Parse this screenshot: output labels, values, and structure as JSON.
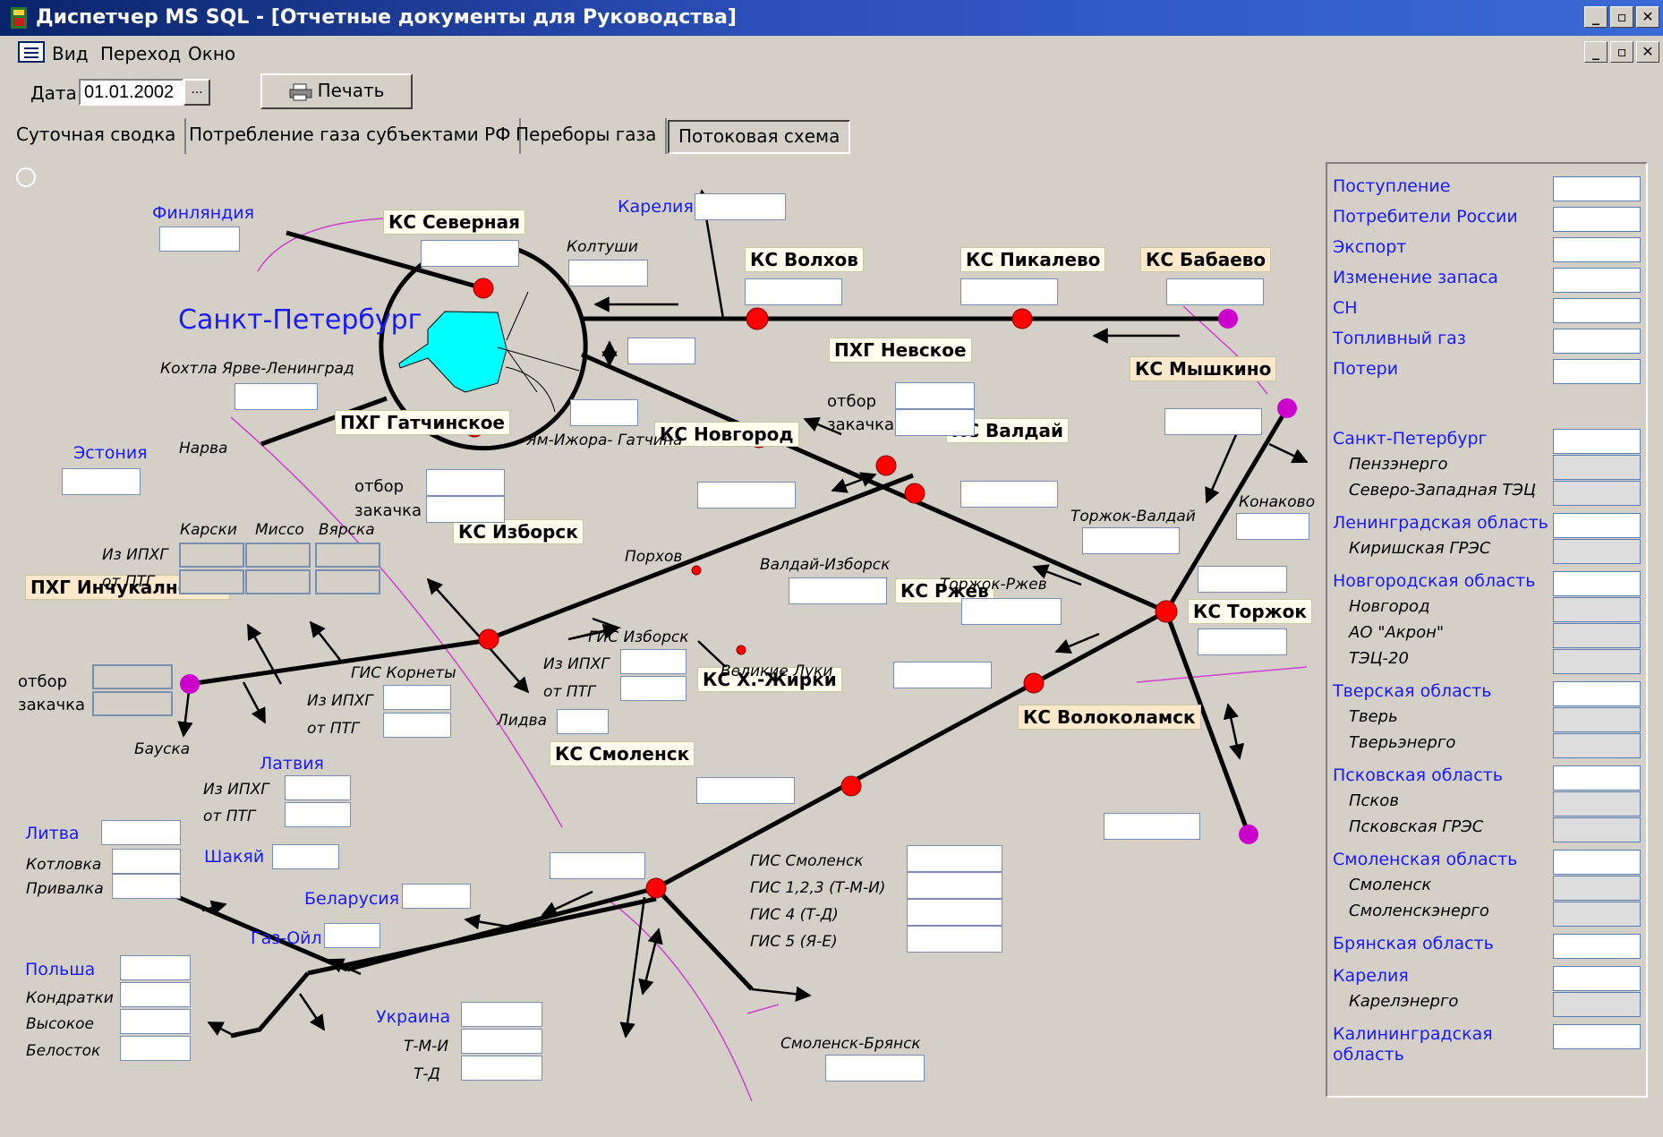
{
  "window": {
    "title": "Диспетчер MS SQL - [Отчетные документы для Руководства]"
  },
  "menu": {
    "items": [
      "Вид",
      "Переход",
      "Окно"
    ]
  },
  "toolbar": {
    "date_label": "Дата",
    "date_value": "01.01.2002",
    "date_button": "...",
    "print_label": "Печать"
  },
  "tabs": [
    {
      "label": "Суточная сводка",
      "active": false
    },
    {
      "label": "Потребление газа субъектами РФ",
      "active": false
    },
    {
      "label": "Переборы газа",
      "active": false
    },
    {
      "label": "Потоковая схема",
      "active": true
    }
  ],
  "scheme": {
    "city": "Санкт-Петербург",
    "stations": {
      "severnaya": "КС Северная",
      "volkhov": "КС Волхов",
      "pikalevo": "КС Пикалево",
      "babaevo": "КС Бабаево",
      "myshkino": "КС Мышкино",
      "nevskoe": "ПХГ Невское",
      "gatchinskoe": "ПХГ Гатчинское",
      "novgorod": "КС Новгород",
      "valday": "КС Валдай",
      "izborsk": "КС Изборск",
      "torzhok": "КС Торжок",
      "inchukalns": "ПХГ Инчукалнское",
      "rzhev": "КС Ржев",
      "zhirki": "КС Х.-Жирки",
      "volokolamsk": "КС Волоколамск",
      "smolensk": "КС Смоленск"
    },
    "regions": {
      "finland": "Финляндия",
      "karelia": "Карелия",
      "estonia": "Эстония",
      "latvia": "Латвия",
      "lithuania": "Литва",
      "shakyai": "Шакяй",
      "belarus": "Беларусия",
      "gas_oil": "Газ-Ойл",
      "poland": "Польша",
      "ukraine": "Украина"
    },
    "labels": {
      "koltushi": "Колтуши",
      "kokhtla": "Кохтла Ярве-Ленинград",
      "narva": "Нарва",
      "otbor": "отбор",
      "zakachka": "закачка",
      "yam_izhora": "Ям-Ижора- Гатчина",
      "karksi": "Карски",
      "misso": "Миссо",
      "varska": "Вярска",
      "iz_iphg": "Из ИПХГ",
      "ot_ptg": "от ПТГ",
      "porkhov": "Порхов",
      "valday_izborsk": "Валдай-Изборск",
      "gis_izborsk": "ГИС Изборск",
      "velikie_luki": "Великие Луки",
      "gis_kornety": "ГИС Корнеты",
      "lidva": "Лидва",
      "bauska": "Бауска",
      "torzhok_valday": "Торжок-Валдай",
      "konakovo": "Конаково",
      "torzhok_rzhev": "Торжок-Ржев",
      "kotlovka": "Котловка",
      "privalka": "Привалка",
      "kondratki": "Кондратки",
      "vysokoe": "Высокое",
      "belostok": "Белосток",
      "gis_smolensk": "ГИС Смоленск",
      "gis_123": "ГИС 1,2,3 (Т-М-И)",
      "gis_4": "ГИС 4 (Т-Д)",
      "gis_5": "ГИС 5 (Я-Е)",
      "tmi": "Т-М-И",
      "td": "Т-Д",
      "smolensk_bryansk": "Смоленск-Брянск"
    }
  },
  "summary": [
    {
      "label": "Поступление",
      "kind": "main"
    },
    {
      "label": "Потребители России",
      "kind": "main"
    },
    {
      "label": "Экспорт",
      "kind": "main"
    },
    {
      "label": "Изменение запаса",
      "kind": "main"
    },
    {
      "label": "СН",
      "kind": "main"
    },
    {
      "label": "Топливный газ",
      "kind": "main"
    },
    {
      "label": "Потери",
      "kind": "main"
    },
    {
      "label": "Санкт-Петербург",
      "kind": "region"
    },
    {
      "label": "Пензэнерго",
      "kind": "sub"
    },
    {
      "label": "Северо-Западная ТЭЦ",
      "kind": "sub"
    },
    {
      "label": "Ленинградская область",
      "kind": "region"
    },
    {
      "label": "Киришская ГРЭС",
      "kind": "sub"
    },
    {
      "label": "Новгородская область",
      "kind": "region"
    },
    {
      "label": "Новгород",
      "kind": "sub"
    },
    {
      "label": "АО \"Акрон\"",
      "kind": "sub"
    },
    {
      "label": "ТЭЦ-20",
      "kind": "sub"
    },
    {
      "label": "Тверская область",
      "kind": "region"
    },
    {
      "label": "Тверь",
      "kind": "sub"
    },
    {
      "label": "Тверьэнерго",
      "kind": "sub"
    },
    {
      "label": "Псковская область",
      "kind": "region"
    },
    {
      "label": "Псков",
      "kind": "sub"
    },
    {
      "label": "Псковская ГРЭС",
      "kind": "sub"
    },
    {
      "label": "Смоленская область",
      "kind": "region"
    },
    {
      "label": "Смоленск",
      "kind": "sub"
    },
    {
      "label": "Смоленскэнерго",
      "kind": "sub"
    },
    {
      "label": "Брянская область",
      "kind": "region"
    },
    {
      "label": "Карелия",
      "kind": "region"
    },
    {
      "label": "Карелэнерго",
      "kind": "sub"
    },
    {
      "label": "Калининградская",
      "kind": "region"
    },
    {
      "label": "область",
      "kind": "region"
    }
  ],
  "colors": {
    "pipe": "#000000",
    "node": "#ff0000",
    "endpoint": "#cc00cc",
    "border_line": "#d040d0",
    "region_text": "#1a1aff",
    "city_fill": "#00ffff"
  }
}
